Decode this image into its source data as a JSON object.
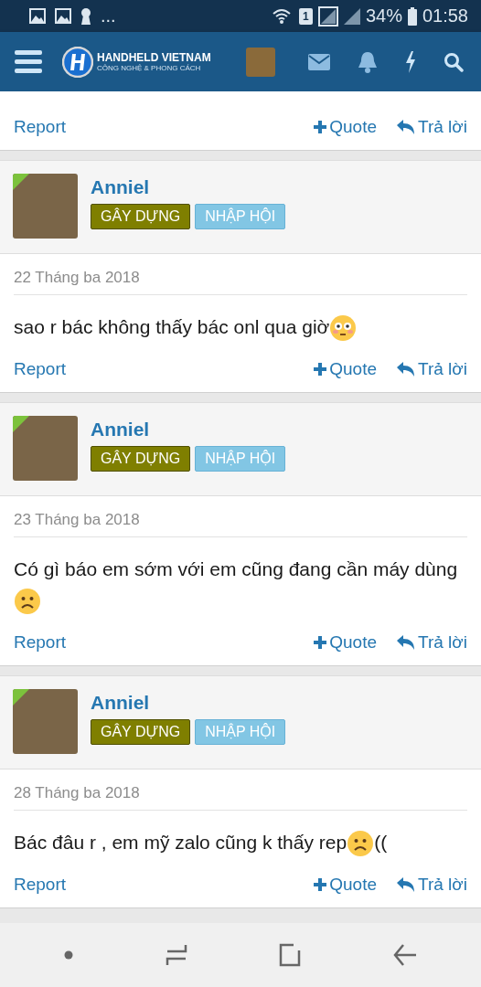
{
  "status_bar": {
    "more": "...",
    "sim": "1",
    "battery": "34%",
    "time": "01:58"
  },
  "header": {
    "brand": "HANDHELD VIETNAM",
    "tagline": "CÔNG NGHỆ & PHONG CÁCH"
  },
  "top_actions": {
    "report": "Report",
    "quote": "Quote",
    "reply": "Trả lời"
  },
  "posts": [
    {
      "author": "Anniel",
      "badges": [
        {
          "label": "GÂY DỰNG",
          "kind": "olive"
        },
        {
          "label": "NHẬP HỘI",
          "kind": "sky"
        }
      ],
      "date": "22 Tháng ba 2018",
      "message": [
        {
          "kind": "text",
          "text": "sao r bác không thấy bác onl qua giờ"
        },
        {
          "kind": "flushed"
        }
      ],
      "report": "Report",
      "quote": "Quote",
      "reply": "Trả lời"
    },
    {
      "author": "Anniel",
      "badges": [
        {
          "label": "GÂY DỰNG",
          "kind": "olive"
        },
        {
          "label": "NHẬP HỘI",
          "kind": "sky"
        }
      ],
      "date": "23 Tháng ba 2018",
      "message": [
        {
          "kind": "text",
          "text": "Có gì báo em sớm với em cũng đang cần máy dùng"
        },
        {
          "kind": "sad"
        }
      ],
      "report": "Report",
      "quote": "Quote",
      "reply": "Trả lời"
    },
    {
      "author": "Anniel",
      "badges": [
        {
          "label": "GÂY DỰNG",
          "kind": "olive"
        },
        {
          "label": "NHẬP HỘI",
          "kind": "sky"
        }
      ],
      "date": "28 Tháng ba 2018",
      "message": [
        {
          "kind": "text",
          "text": "Bác đâu r , em mỹ zalo cũng k thấy rep"
        },
        {
          "kind": "sad"
        },
        {
          "kind": "text",
          "text": "(("
        }
      ],
      "report": "Report",
      "quote": "Quote",
      "reply": "Trả lời"
    }
  ]
}
